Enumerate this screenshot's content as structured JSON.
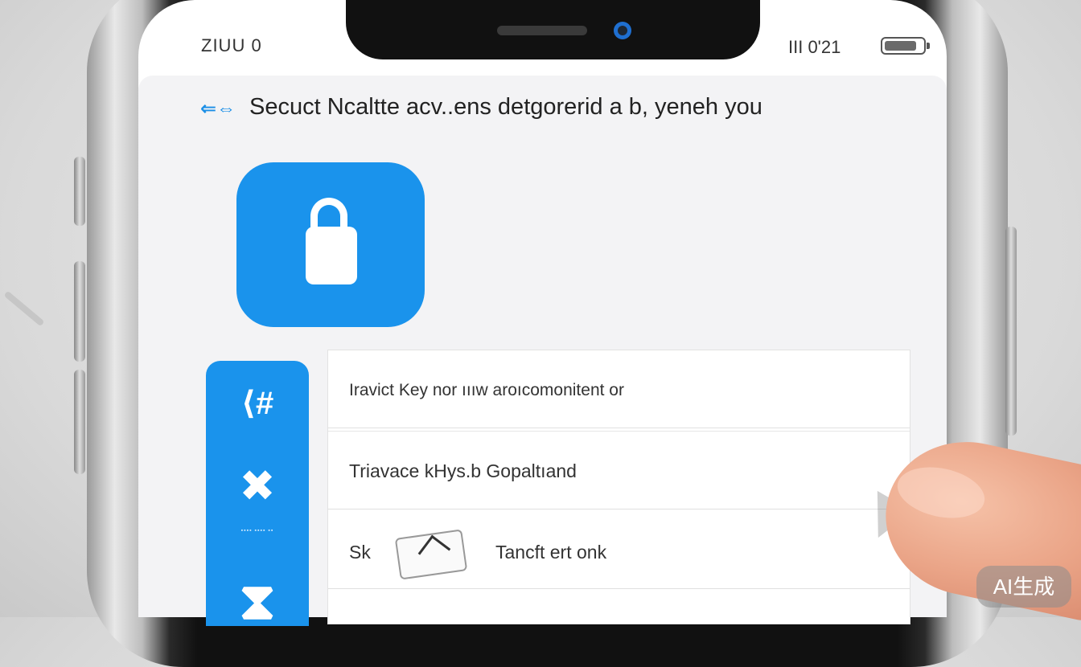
{
  "status_bar": {
    "left_text": "ZIUU 0",
    "right_text": "III 0'21",
    "battery_level": 0.85
  },
  "header": {
    "icon": "back-arrows-icon",
    "icon_glyph": "⇐⇔",
    "title": "Secuct Ncaltte acv..ens detgorerid  a  b, yeneh you"
  },
  "lock_tile": {
    "icon": "lock-icon"
  },
  "side_rail": {
    "icon_1": {
      "name": "network-icon",
      "glyph": "⟨#"
    },
    "icon_2": {
      "name": "people-icon",
      "glyph": "✖"
    },
    "caption": "▪▪▪▪ ▪▪▪▪ ▪▪",
    "icon_3": {
      "name": "hourglass-icon",
      "glyph": "⧗"
    }
  },
  "list": {
    "row_1": "Iravict Key nor ıııw aroıcomonitent or",
    "row_2": "Triavace kHys.b Gopaltıand",
    "row_3_prefix": "Sk",
    "row_3_text": "Tancft ert onk"
  },
  "badge": {
    "label": "AI生成"
  }
}
